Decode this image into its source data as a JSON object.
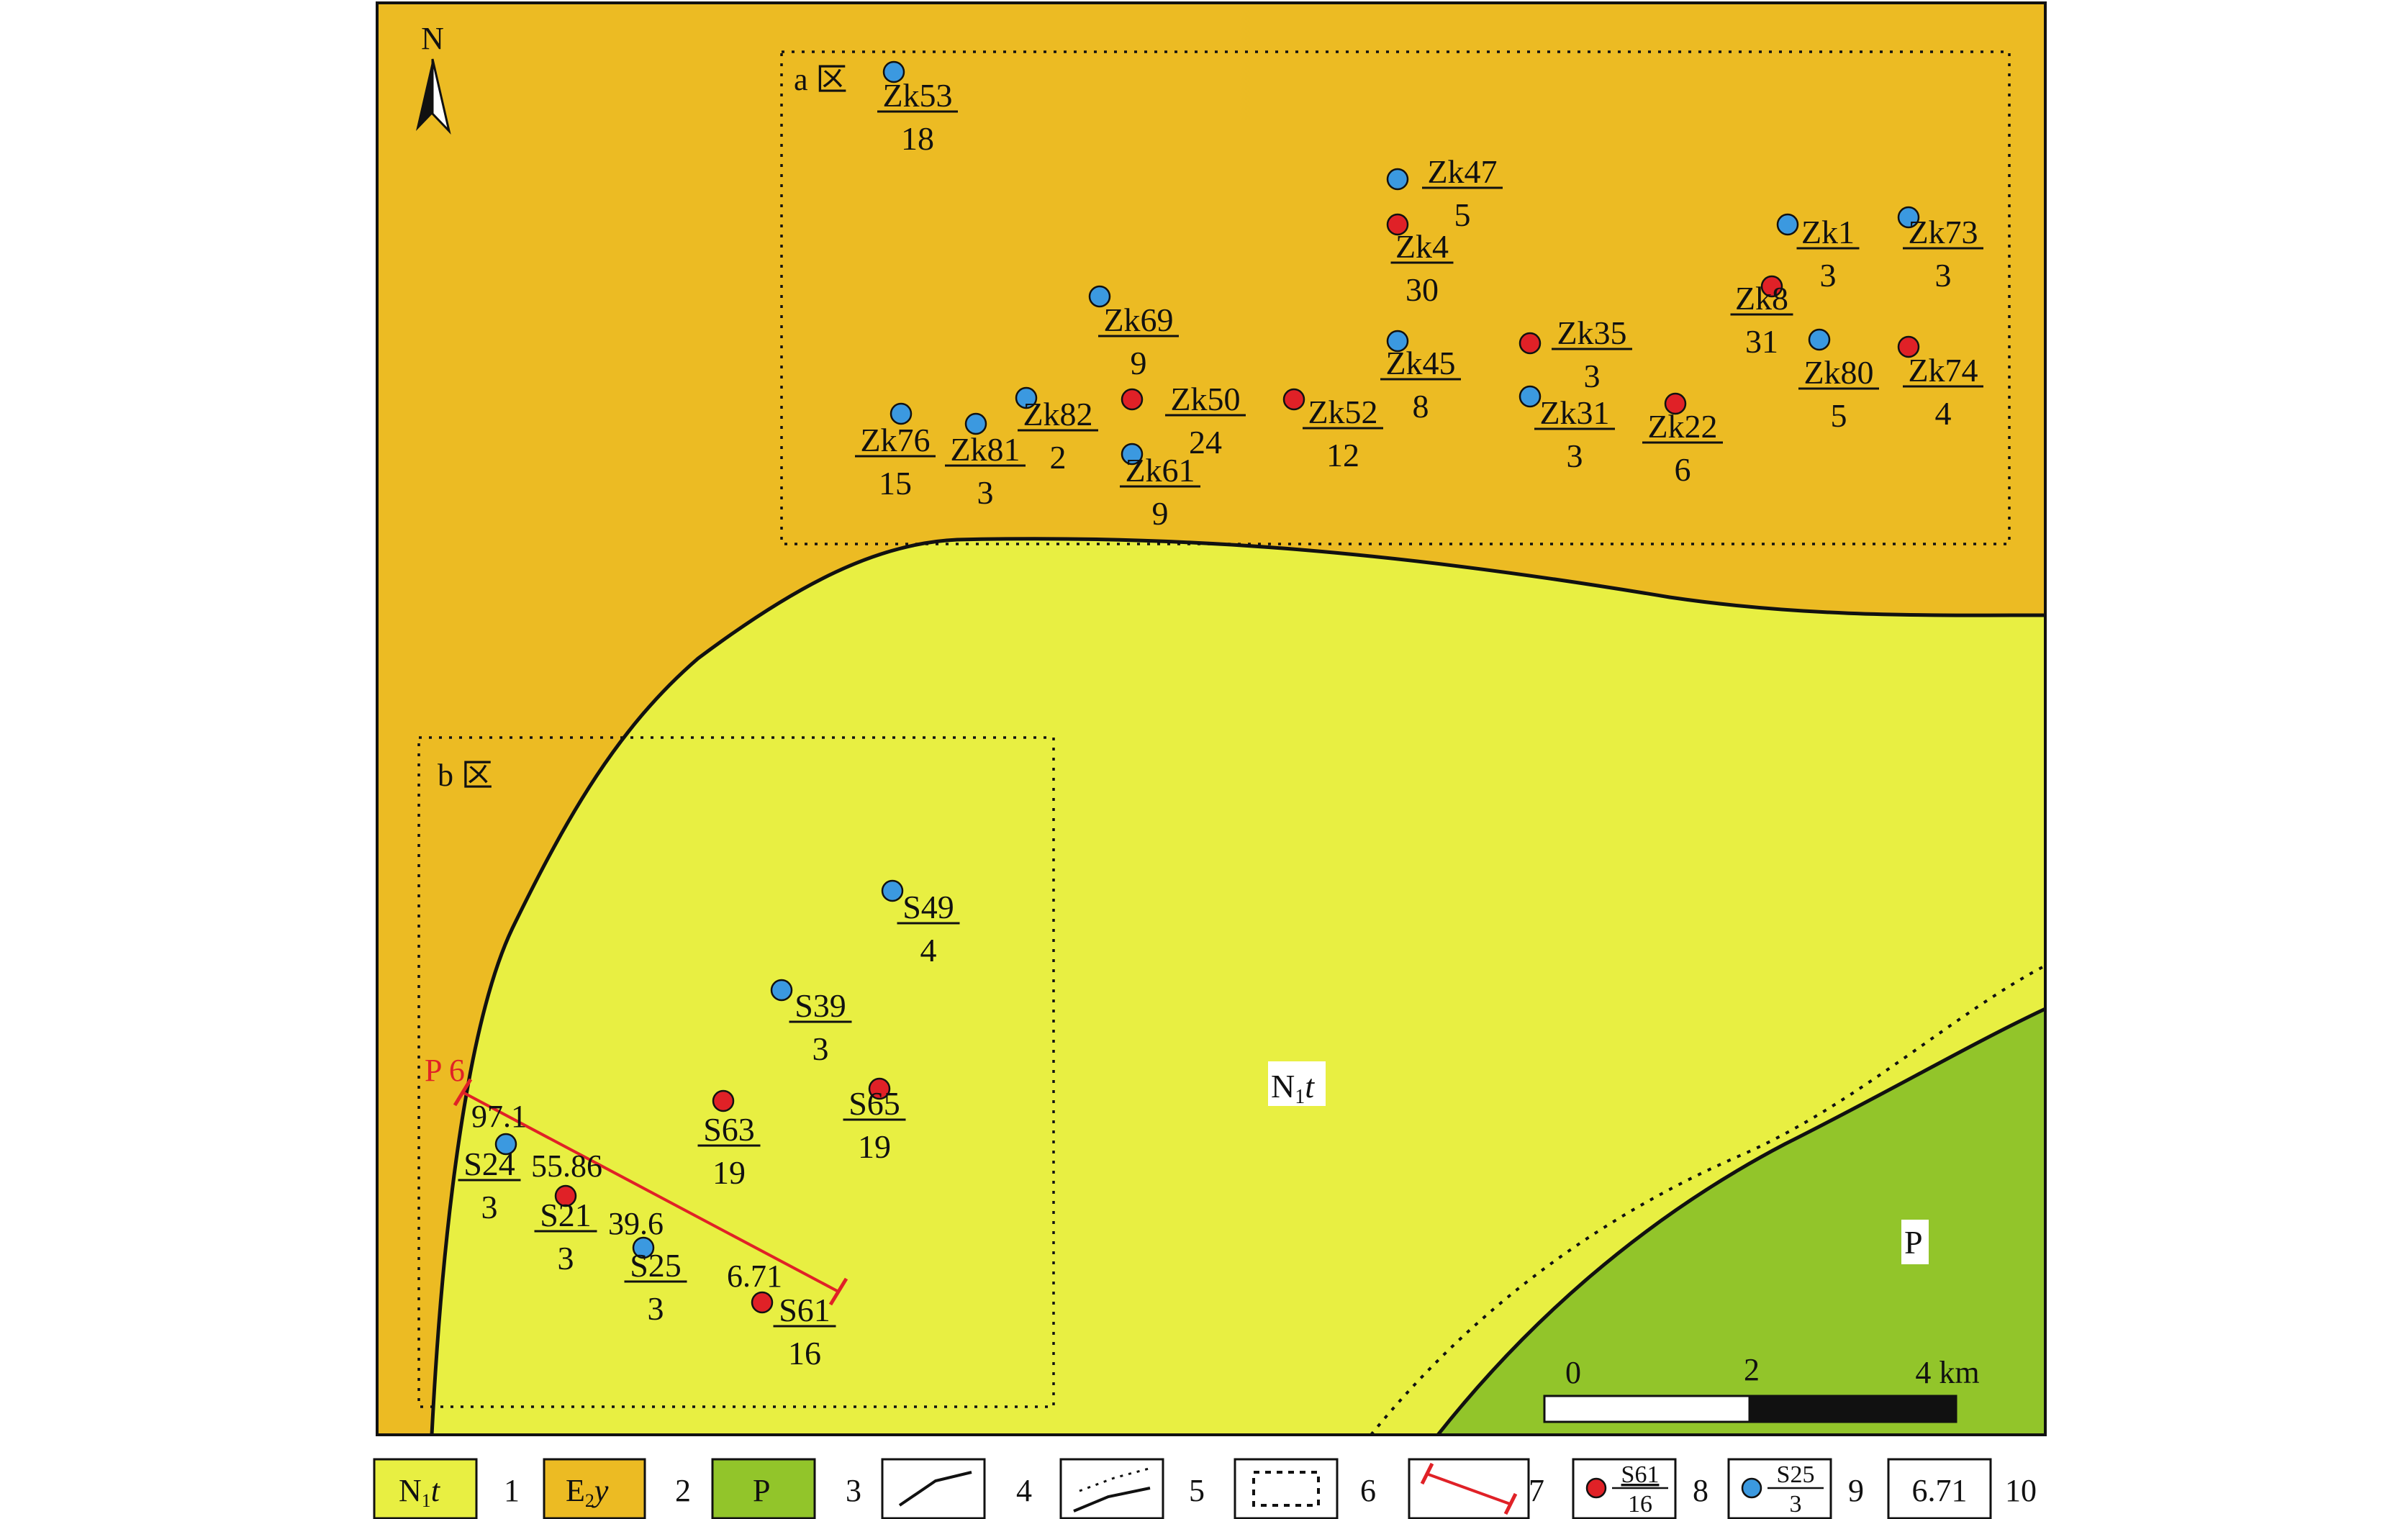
{
  "map": {
    "north_label": "N",
    "zone_a_label": "a 区",
    "zone_b_label": "b 区",
    "unit_labels": {
      "n1t_main": "N",
      "n1t_sub": "1",
      "n1t_tail": "t",
      "p": "P"
    },
    "profile": {
      "label": "P 6",
      "values": [
        "97.1",
        "55.86",
        "39.6",
        "6.71"
      ]
    },
    "scale": {
      "ticks": [
        "0",
        "2",
        "4 km"
      ]
    },
    "colors": {
      "n1t": "#e8ef42",
      "e2y": "#ecbb23",
      "p": "#92c52a",
      "red_marker": "#e02127",
      "blue_marker": "#3b99e0",
      "profile_line": "#e02127"
    },
    "wells": [
      {
        "name": "Zk53",
        "value": "18",
        "color": "blue"
      },
      {
        "name": "Zk47",
        "value": "5",
        "color": "blue"
      },
      {
        "name": "Zk4",
        "value": "30",
        "color": "red"
      },
      {
        "name": "Zk1",
        "value": "3",
        "color": "blue"
      },
      {
        "name": "Zk73",
        "value": "3",
        "color": "blue"
      },
      {
        "name": "Zk8",
        "value": "31",
        "color": "red"
      },
      {
        "name": "Zk80",
        "value": "5",
        "color": "blue"
      },
      {
        "name": "Zk74",
        "value": "4",
        "color": "red"
      },
      {
        "name": "Zk69",
        "value": "9",
        "color": "blue"
      },
      {
        "name": "Zk35",
        "value": "3",
        "color": "red"
      },
      {
        "name": "Zk45",
        "value": "8",
        "color": "blue"
      },
      {
        "name": "Zk31",
        "value": "3",
        "color": "blue"
      },
      {
        "name": "Zk22",
        "value": "6",
        "color": "red"
      },
      {
        "name": "Zk52",
        "value": "12",
        "color": "red"
      },
      {
        "name": "Zk50",
        "value": "24",
        "color": "red"
      },
      {
        "name": "Zk61",
        "value": "9",
        "color": "blue"
      },
      {
        "name": "Zk82",
        "value": "2",
        "color": "blue"
      },
      {
        "name": "Zk81",
        "value": "3",
        "color": "blue"
      },
      {
        "name": "Zk76",
        "value": "15",
        "color": "blue"
      },
      {
        "name": "S49",
        "value": "4",
        "color": "blue"
      },
      {
        "name": "S39",
        "value": "3",
        "color": "blue"
      },
      {
        "name": "S65",
        "value": "19",
        "color": "red"
      },
      {
        "name": "S63",
        "value": "19",
        "color": "red"
      },
      {
        "name": "S24",
        "value": "3",
        "color": "blue"
      },
      {
        "name": "S21",
        "value": "3",
        "color": "red"
      },
      {
        "name": "S25",
        "value": "3",
        "color": "blue"
      },
      {
        "name": "S61",
        "value": "16",
        "color": "red"
      }
    ]
  },
  "legend": {
    "items": [
      {
        "num": "1",
        "main": "N",
        "sub": "1",
        "tail": "t"
      },
      {
        "num": "2",
        "main": "E",
        "sub": "2",
        "tail": "y"
      },
      {
        "num": "3",
        "main": "P"
      },
      {
        "num": "4"
      },
      {
        "num": "5"
      },
      {
        "num": "6"
      },
      {
        "num": "7"
      },
      {
        "num": "8",
        "well_name": "S61",
        "well_value": "16"
      },
      {
        "num": "9",
        "well_name": "S25",
        "well_value": "3"
      },
      {
        "num": "10",
        "value": "6.71"
      }
    ]
  }
}
